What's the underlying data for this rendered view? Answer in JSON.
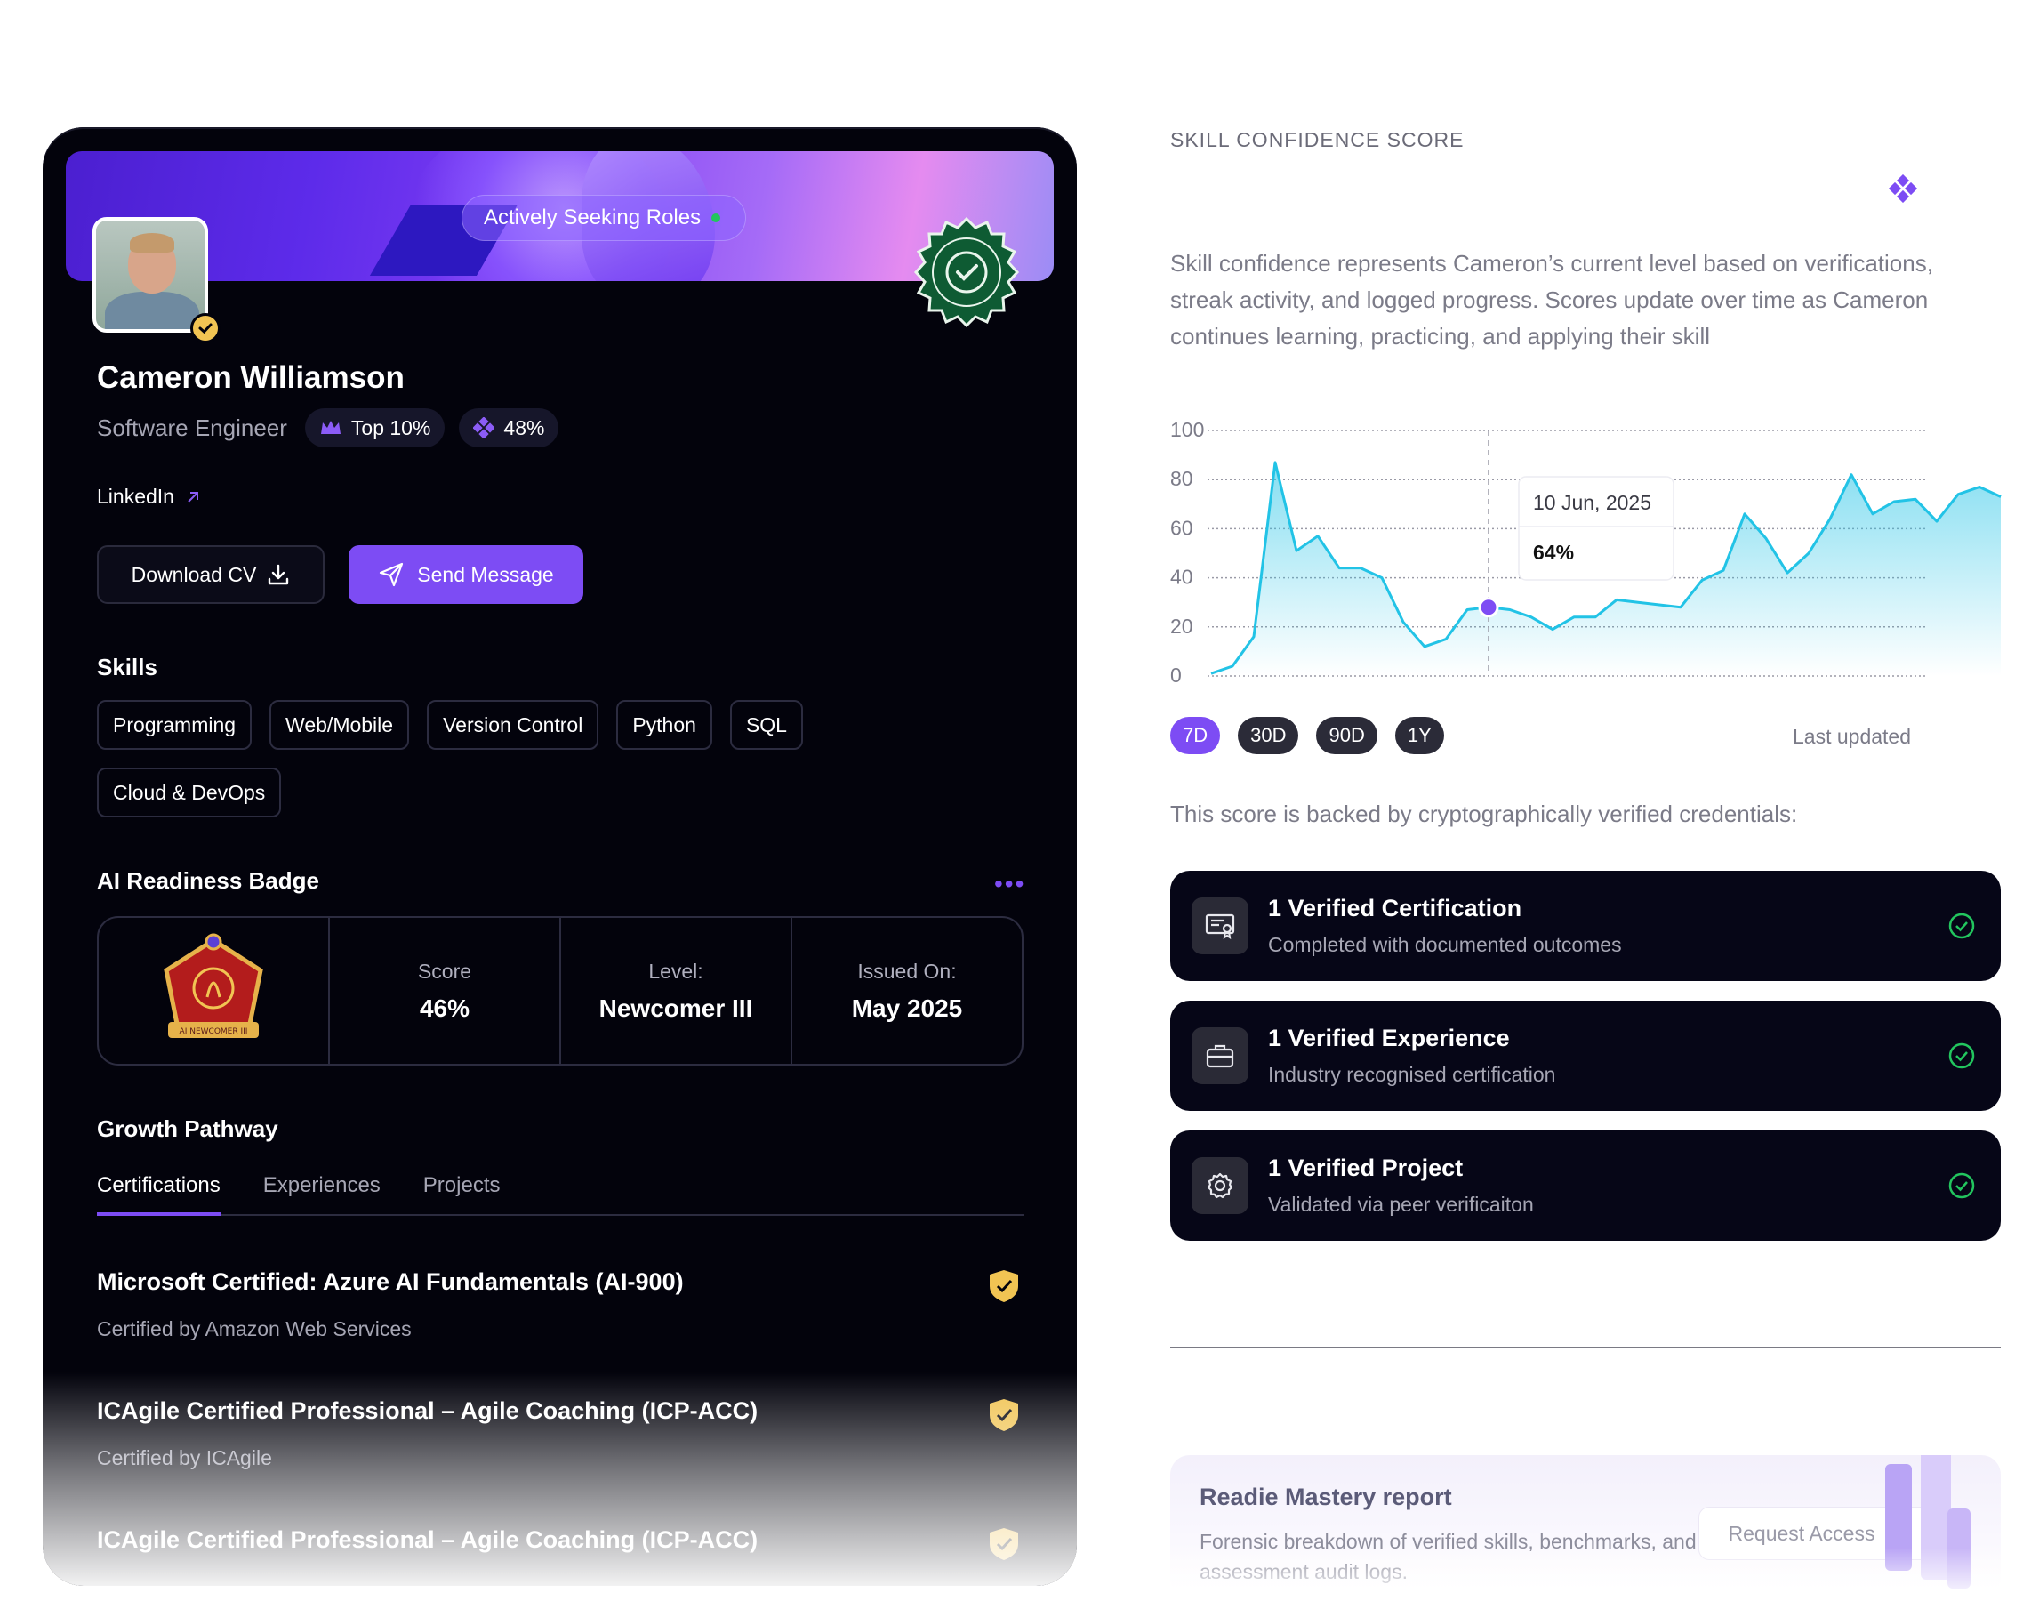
{
  "profile": {
    "status": "Actively Seeking Roles",
    "name": "Cameron Williamson",
    "role": "Software Engineer",
    "rank": "Top 10%",
    "percent": "48%",
    "linkedin": "LinkedIn",
    "download_cv": "Download CV",
    "send_message": "Send Message"
  },
  "skills": {
    "title": "Skills",
    "items": [
      "Programming",
      "Web/Mobile",
      "Version Control",
      "Python",
      "SQL",
      "Cloud & DevOps"
    ]
  },
  "badge": {
    "title": "AI Readiness Badge",
    "emblem_text": "AI NEWCOMER III",
    "score_label": "Score",
    "score_value": "46%",
    "level_label": "Level:",
    "level_value": "Newcomer III",
    "issued_label": "Issued On:",
    "issued_value": "May 2025"
  },
  "growth": {
    "title": "Growth Pathway",
    "tabs": [
      "Certifications",
      "Experiences",
      "Projects"
    ],
    "certifications": [
      {
        "title": "Microsoft Certified: Azure AI Fundamentals (AI-900)",
        "issuer": "Certified by Amazon Web Services"
      },
      {
        "title": "ICAgile Certified Professional – Agile Coaching (ICP-ACC)",
        "issuer": "Certified by ICAgile"
      },
      {
        "title": "ICAgile Certified Professional – Agile Coaching (ICP-ACC)",
        "issuer": ""
      }
    ]
  },
  "confidence": {
    "eyebrow": "SKILL CONFIDENCE SCORE",
    "description": "Skill confidence represents Cameron’s current level based on verifications, streak activity, and logged progress. Scores update over time as Cameron continues learning, practicing, and applying their skill",
    "ranges": [
      "7D",
      "30D",
      "90D",
      "1Y"
    ],
    "active_range": "7D",
    "last_updated": "Last updated",
    "backed_text": "This score is backed by cryptographically verified credentials:"
  },
  "chart_data": {
    "type": "area",
    "y_ticks": [
      "100",
      "80",
      "60",
      "40",
      "20",
      "0"
    ],
    "ylim": [
      0,
      100
    ],
    "grid": true,
    "values": [
      1,
      4,
      16,
      87,
      51,
      57,
      44,
      44,
      40,
      22,
      12,
      15,
      27,
      28,
      27,
      24,
      19,
      24,
      24,
      31,
      30,
      29,
      28,
      39,
      43,
      66,
      56,
      42,
      50,
      64,
      82,
      66,
      71,
      72,
      63,
      74,
      77,
      73
    ],
    "highlight_index": 13,
    "tooltip_date": "10 Jun, 2025",
    "tooltip_value": "64%",
    "line_color": "#22c3e6",
    "marker_color": "#7d4cf4"
  },
  "verified": [
    {
      "title": "1 Verified Certification",
      "subtitle": "Completed with documented outcomes",
      "icon": "certificate-icon"
    },
    {
      "title": "1 Verified Experience",
      "subtitle": "Industry recognised certification",
      "icon": "briefcase-icon"
    },
    {
      "title": "1 Verified Project",
      "subtitle": "Validated via peer verificaiton",
      "icon": "gear-icon"
    }
  ],
  "report": {
    "title": "Readie Mastery report",
    "subtitle": "Forensic breakdown of verified skills, benchmarks, and assessment audit logs.",
    "request": "Request Access"
  },
  "colors": {
    "accent": "#7d4cf4",
    "success": "#22c55e",
    "card_bg": "#03030c"
  }
}
